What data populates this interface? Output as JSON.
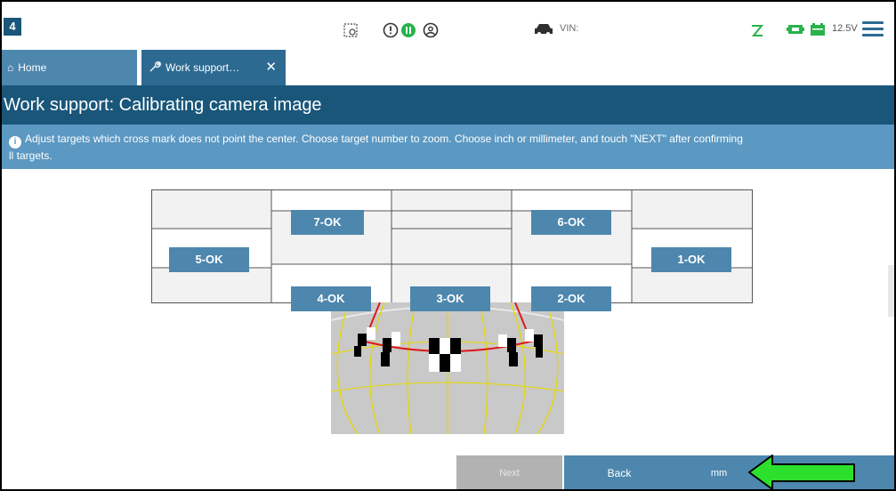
{
  "app": {
    "logo_text": "4"
  },
  "status_bar": {
    "vin_label": "VIN:",
    "battery_voltage": "12.5V",
    "icons": [
      "screenshot-icon",
      "alert-icon",
      "pause-icon",
      "user-icon",
      "car-icon",
      "wireless-icon",
      "vci-icon",
      "battery-icon",
      "menu-icon"
    ],
    "colors": {
      "accent": "#2a6b94",
      "ok_green": "#27b34a"
    }
  },
  "tabs": [
    {
      "label": "Home",
      "icon": "home-icon"
    },
    {
      "label": "Work support…",
      "icon": "wrench-icon",
      "active": true
    }
  ],
  "header": {
    "title": "Work support: Calibrating camera image"
  },
  "instructions": {
    "text": "Adjust targets which cross mark does not point the center. Choose target number to zoom. Choose inch or millimeter, and touch \"NEXT\" after confirming all targets.",
    "line1": "Adjust targets which cross mark does not point the center. Choose target number to zoom. Choose inch or millimeter, and touch \"NEXT\" after confirming",
    "line2": "ll targets."
  },
  "targets": [
    {
      "id": 7,
      "label": "7-OK"
    },
    {
      "id": 6,
      "label": "6-OK"
    },
    {
      "id": 5,
      "label": "5-OK"
    },
    {
      "id": 1,
      "label": "1-OK"
    },
    {
      "id": 4,
      "label": "4-OK"
    },
    {
      "id": 3,
      "label": "3-OK"
    },
    {
      "id": 2,
      "label": "2-OK"
    }
  ],
  "buttons": {
    "next": "Next",
    "back": "Back",
    "unit": "mm"
  },
  "annotation": {
    "arrow_color": "#2ee02e"
  }
}
